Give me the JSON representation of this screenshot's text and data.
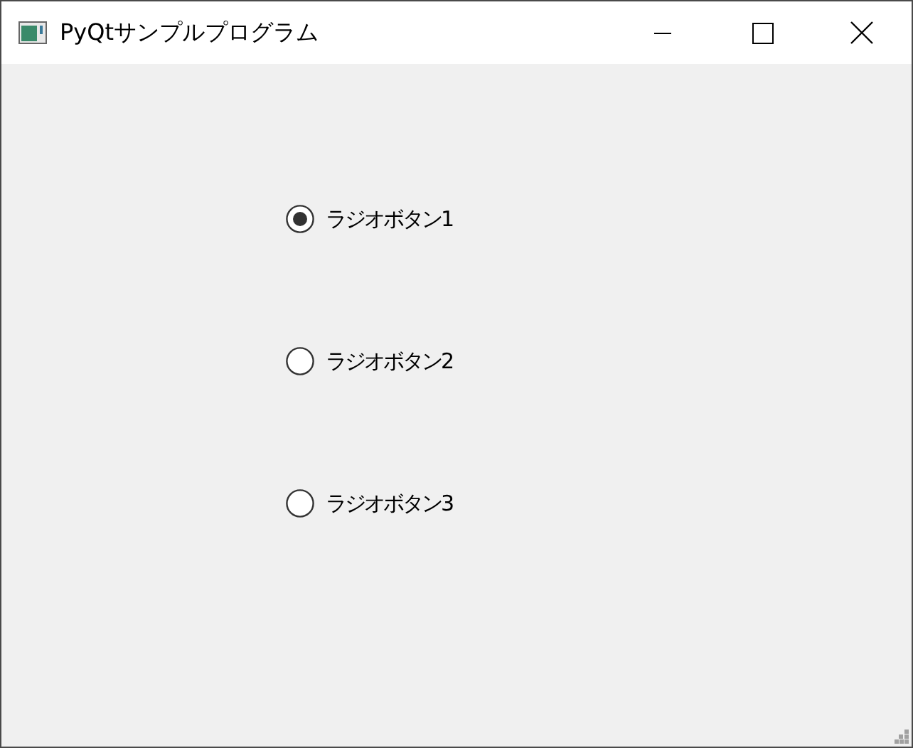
{
  "window": {
    "title": "PyQtサンプルプログラム"
  },
  "radio_buttons": [
    {
      "label": "ラジオボタン1",
      "selected": true
    },
    {
      "label": "ラジオボタン2",
      "selected": false
    },
    {
      "label": "ラジオボタン3",
      "selected": false
    }
  ]
}
